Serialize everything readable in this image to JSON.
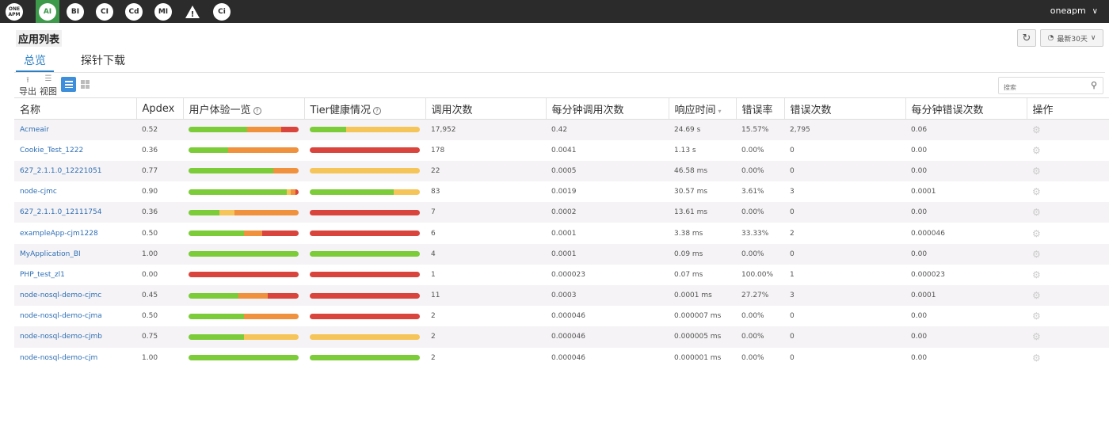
{
  "topbar": {
    "logo": "ONE APM",
    "nav": [
      "AI",
      "BI",
      "CI",
      "Cd",
      "MI",
      "!",
      "Ci"
    ],
    "user": "oneapm"
  },
  "header": {
    "title": "应用列表",
    "tabs": [
      "总览",
      "探针下载"
    ],
    "range_label": "最新30天"
  },
  "toolbar": {
    "export_label": "导出",
    "view_label": "视图",
    "search_placeholder": "搜索"
  },
  "colors": {
    "green": "#7ccc3a",
    "orange": "#f0913e",
    "red": "#d9453c",
    "yellow": "#f6c55a",
    "accent": "#2a7fc4"
  },
  "table": {
    "columns": [
      "名称",
      "Apdex",
      "用户体验一览",
      "Tier健康情况",
      "调用次数",
      "每分钟调用次数",
      "响应时间",
      "错误率",
      "错误次数",
      "每分钟错误次数",
      "操作"
    ],
    "rows": [
      {
        "name": "Acmeair",
        "apdex": "0.52",
        "ux": [
          [
            "green",
            0.53
          ],
          [
            "orange",
            0.31
          ],
          [
            "red",
            0.16
          ]
        ],
        "tier": [
          [
            "green",
            0.33
          ],
          [
            "yellow",
            0.67
          ]
        ],
        "calls": "17,952",
        "cpm": "0.42",
        "resp": "24.69 s",
        "err_rate": "15.57%",
        "errors": "2,795",
        "epm": "0.06"
      },
      {
        "name": "Cookie_Test_1222",
        "apdex": "0.36",
        "ux": [
          [
            "green",
            0.36
          ],
          [
            "orange",
            0.64
          ]
        ],
        "tier": [
          [
            "red",
            1.0
          ]
        ],
        "calls": "178",
        "cpm": "0.0041",
        "resp": "1.13 s",
        "err_rate": "0.00%",
        "errors": "0",
        "epm": "0.00"
      },
      {
        "name": "627_2.1.1.0_12221051",
        "apdex": "0.77",
        "ux": [
          [
            "green",
            0.77
          ],
          [
            "orange",
            0.23
          ]
        ],
        "tier": [
          [
            "yellow",
            1.0
          ]
        ],
        "calls": "22",
        "cpm": "0.0005",
        "resp": "46.58 ms",
        "err_rate": "0.00%",
        "errors": "0",
        "epm": "0.00"
      },
      {
        "name": "node-cjmc",
        "apdex": "0.90",
        "ux": [
          [
            "green",
            0.89
          ],
          [
            "yellow",
            0.04
          ],
          [
            "orange",
            0.04
          ],
          [
            "red",
            0.03
          ]
        ],
        "tier": [
          [
            "green",
            0.76
          ],
          [
            "yellow",
            0.24
          ]
        ],
        "calls": "83",
        "cpm": "0.0019",
        "resp": "30.57 ms",
        "err_rate": "3.61%",
        "errors": "3",
        "epm": "0.0001"
      },
      {
        "name": "627_2.1.1.0_12111754",
        "apdex": "0.36",
        "ux": [
          [
            "green",
            0.28
          ],
          [
            "yellow",
            0.14
          ],
          [
            "orange",
            0.58
          ]
        ],
        "tier": [
          [
            "red",
            1.0
          ]
        ],
        "calls": "7",
        "cpm": "0.0002",
        "resp": "13.61 ms",
        "err_rate": "0.00%",
        "errors": "0",
        "epm": "0.00"
      },
      {
        "name": "exampleApp-cjm1228",
        "apdex": "0.50",
        "ux": [
          [
            "green",
            0.5
          ],
          [
            "orange",
            0.17
          ],
          [
            "red",
            0.33
          ]
        ],
        "tier": [
          [
            "red",
            1.0
          ]
        ],
        "calls": "6",
        "cpm": "0.0001",
        "resp": "3.38 ms",
        "err_rate": "33.33%",
        "errors": "2",
        "epm": "0.000046"
      },
      {
        "name": "MyApplication_BI",
        "apdex": "1.00",
        "ux": [
          [
            "green",
            1.0
          ]
        ],
        "tier": [
          [
            "green",
            1.0
          ]
        ],
        "calls": "4",
        "cpm": "0.0001",
        "resp": "0.09 ms",
        "err_rate": "0.00%",
        "errors": "0",
        "epm": "0.00"
      },
      {
        "name": "PHP_test_zl1",
        "apdex": "0.00",
        "ux": [
          [
            "red",
            1.0
          ]
        ],
        "tier": [
          [
            "red",
            1.0
          ]
        ],
        "calls": "1",
        "cpm": "0.000023",
        "resp": "0.07 ms",
        "err_rate": "100.00%",
        "errors": "1",
        "epm": "0.000023"
      },
      {
        "name": "node-nosql-demo-cjmc",
        "apdex": "0.45",
        "ux": [
          [
            "green",
            0.45
          ],
          [
            "orange",
            0.27
          ],
          [
            "red",
            0.28
          ]
        ],
        "tier": [
          [
            "red",
            1.0
          ]
        ],
        "calls": "11",
        "cpm": "0.0003",
        "resp": "0.0001 ms",
        "err_rate": "27.27%",
        "errors": "3",
        "epm": "0.0001"
      },
      {
        "name": "node-nosql-demo-cjma",
        "apdex": "0.50",
        "ux": [
          [
            "green",
            0.5
          ],
          [
            "orange",
            0.5
          ]
        ],
        "tier": [
          [
            "red",
            1.0
          ]
        ],
        "calls": "2",
        "cpm": "0.000046",
        "resp": "0.000007 ms",
        "err_rate": "0.00%",
        "errors": "0",
        "epm": "0.00"
      },
      {
        "name": "node-nosql-demo-cjmb",
        "apdex": "0.75",
        "ux": [
          [
            "green",
            0.5
          ],
          [
            "yellow",
            0.5
          ]
        ],
        "tier": [
          [
            "yellow",
            1.0
          ]
        ],
        "calls": "2",
        "cpm": "0.000046",
        "resp": "0.000005 ms",
        "err_rate": "0.00%",
        "errors": "0",
        "epm": "0.00"
      },
      {
        "name": "node-nosql-demo-cjm",
        "apdex": "1.00",
        "ux": [
          [
            "green",
            1.0
          ]
        ],
        "tier": [
          [
            "green",
            1.0
          ]
        ],
        "calls": "2",
        "cpm": "0.000046",
        "resp": "0.000001 ms",
        "err_rate": "0.00%",
        "errors": "0",
        "epm": "0.00"
      }
    ]
  }
}
